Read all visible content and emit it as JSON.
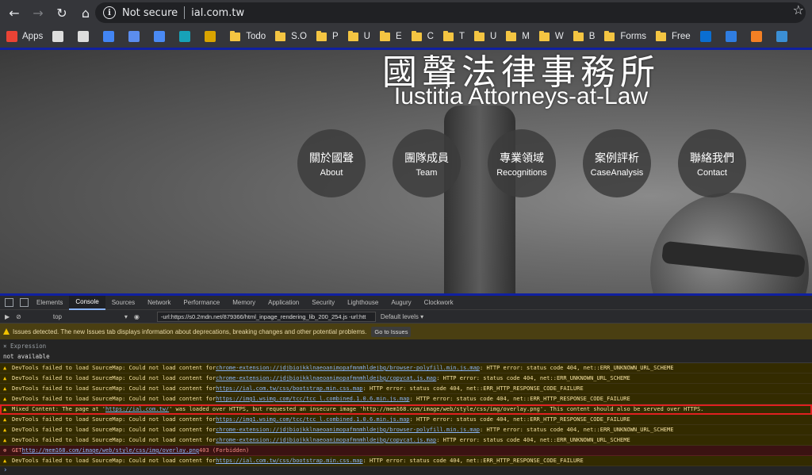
{
  "browser": {
    "security_label": "Not secure",
    "url": "ial.com.tw",
    "bookmarks": [
      {
        "label": "Apps",
        "icon": "apps-grid-icon",
        "color": "#ea4335"
      },
      {
        "label": "",
        "icon": "gear-icon",
        "color": "#dddddd"
      },
      {
        "label": "",
        "icon": "star-icon",
        "color": "#dddddd"
      },
      {
        "label": "",
        "icon": "google-icon",
        "color": "#4285f4"
      },
      {
        "label": "",
        "icon": "photos-icon",
        "color": "#5b8def"
      },
      {
        "label": "",
        "icon": "translate-icon",
        "color": "#4a8af4"
      },
      {
        "label": "",
        "icon": "bing-icon",
        "color": "#17a2b8"
      },
      {
        "label": "",
        "icon": "circle-logo-icon",
        "color": "#d9a400"
      },
      {
        "label": "Todo",
        "icon": "folder-icon"
      },
      {
        "label": "S.O",
        "icon": "folder-icon"
      },
      {
        "label": "P",
        "icon": "folder-icon"
      },
      {
        "label": "U",
        "icon": "folder-icon"
      },
      {
        "label": "E",
        "icon": "folder-icon"
      },
      {
        "label": "C",
        "icon": "folder-icon"
      },
      {
        "label": "T",
        "icon": "folder-icon"
      },
      {
        "label": "U",
        "icon": "folder-icon"
      },
      {
        "label": "M",
        "icon": "folder-icon"
      },
      {
        "label": "W",
        "icon": "folder-icon"
      },
      {
        "label": "B",
        "icon": "folder-icon"
      },
      {
        "label": "Forms",
        "icon": "folder-icon"
      },
      {
        "label": "Free",
        "icon": "folder-icon"
      },
      {
        "label": "",
        "icon": "outlook-icon",
        "color": "#0a6ed1"
      },
      {
        "label": "",
        "icon": "azure-icon",
        "color": "#2f7de1"
      },
      {
        "label": "",
        "icon": "stack-icon",
        "color": "#f48024"
      },
      {
        "label": "",
        "icon": "wordpress-icon",
        "color": "#3b8fd5"
      }
    ]
  },
  "site": {
    "title_zh": "國聲法律事務所",
    "title_en": "Iustitia Attorneys-at-Law",
    "nav": [
      {
        "zh": "關於國聲",
        "en": "About"
      },
      {
        "zh": "團隊成員",
        "en": "Team"
      },
      {
        "zh": "專業領域",
        "en": "Recognitions"
      },
      {
        "zh": "案例評析",
        "en": "CaseAnalysis"
      },
      {
        "zh": "聯絡我們",
        "en": "Contact"
      }
    ]
  },
  "devtools": {
    "tabs": [
      "Elements",
      "Console",
      "Sources",
      "Network",
      "Performance",
      "Memory",
      "Application",
      "Security",
      "Lighthouse",
      "Augury",
      "Clockwork"
    ],
    "active_tab": "Console",
    "context": "top",
    "filter_value": "-url:https://s0.2mdn.net/879366/html_inpage_rendering_lib_200_254.js -url:htt",
    "levels_label": "Default levels ▾",
    "issues_text": "Issues detected. The new Issues tab displays information about deprecations, breaking changes and other potential problems.",
    "go_to_issues": "Go to Issues",
    "expression_label": "Expression",
    "expression_value": "not available",
    "logs": [
      {
        "type": "warn",
        "pre": "DevTools failed to load SourceMap: Could not load content for ",
        "link": "chrome-extension://jdjbiojkklnaeoanimopafmnmhldejbg/browser-polyfill.min.js.map",
        "post": ": HTTP error: status code 404, net::ERR_UNKNOWN_URL_SCHEME"
      },
      {
        "type": "warn",
        "pre": "DevTools failed to load SourceMap: Could not load content for ",
        "link": "chrome-extension://jdjbiojkklnaeoanimopafmnmhldejbg/copycat.js.map",
        "post": ": HTTP error: status code 404, net::ERR_UNKNOWN_URL_SCHEME"
      },
      {
        "type": "warn",
        "pre": "DevTools failed to load SourceMap: Could not load content for ",
        "link": "https://ial.com.tw/css/bootstrap.min.css.map",
        "post": ": HTTP error: status code 404, net::ERR_HTTP_RESPONSE_CODE_FAILURE"
      },
      {
        "type": "warn",
        "pre": "DevTools failed to load SourceMap: Could not load content for ",
        "link": "https://img1.wsimg.com/tcc/tcc_l.combined.1.0.6.min.js.map",
        "post": ": HTTP error: status code 404, net::ERR_HTTP_RESPONSE_CODE_FAILURE"
      },
      {
        "type": "warn mixed",
        "pre": "Mixed Content: The page at '",
        "link": "https://ial.com.tw/",
        "post": "' was loaded over HTTPS, but requested an insecure image 'http://mem168.com/image/web/style/css/img/overlay.png'. This content should also be served over HTTPS."
      },
      {
        "type": "warn",
        "pre": "DevTools failed to load SourceMap: Could not load content for ",
        "link": "https://img1.wsimg.com/tcc/tcc_l.combined.1.0.6.min.js.map",
        "post": ": HTTP error: status code 404, net::ERR_HTTP_RESPONSE_CODE_FAILURE"
      },
      {
        "type": "warn",
        "pre": "DevTools failed to load SourceMap: Could not load content for ",
        "link": "chrome-extension://jdjbiojkklnaeoanimopafmnmhldejbg/browser-polyfill.min.js.map",
        "post": ": HTTP error: status code 404, net::ERR_UNKNOWN_URL_SCHEME"
      },
      {
        "type": "warn",
        "pre": "DevTools failed to load SourceMap: Could not load content for ",
        "link": "chrome-extension://jdjbiojkklnaeoanimopafmnmhldejbg/copycat.js.map",
        "post": ": HTTP error: status code 404, net::ERR_UNKNOWN_URL_SCHEME"
      },
      {
        "type": "error",
        "pre": "GET ",
        "link": "http://mem168.com/image/web/style/css/img/overlay.png",
        "post": " 403 (Forbidden)"
      },
      {
        "type": "warn",
        "pre": "DevTools failed to load SourceMap: Could not load content for ",
        "link": "https://ial.com.tw/css/bootstrap.min.css.map",
        "post": ": HTTP error: status code 404, net::ERR_HTTP_RESPONSE_CODE_FAILURE"
      }
    ],
    "prompt_symbol": "›"
  }
}
